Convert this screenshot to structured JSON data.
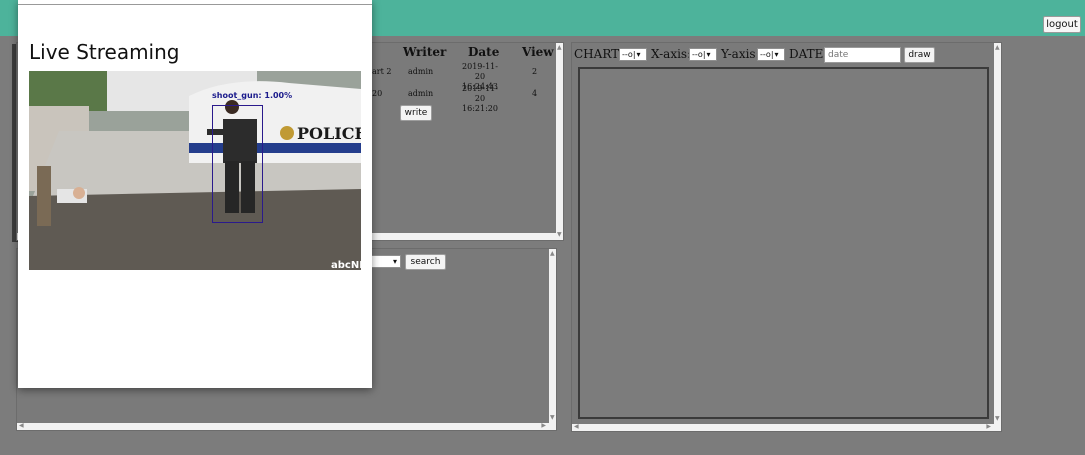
{
  "header": {
    "logout_label": "logout"
  },
  "board": {
    "columns": [
      "Writer",
      "Date",
      "View"
    ],
    "rows": [
      {
        "title": "art 2",
        "writer": "admin",
        "date": "2019-11-20",
        "time": "16:24:43",
        "views": "2"
      },
      {
        "title": "20",
        "writer": "admin",
        "date": "2019-11-20",
        "time": "16:21:20",
        "views": "4"
      }
    ],
    "write_label": "write"
  },
  "search": {
    "button_label": "search",
    "select_arrow": "▾"
  },
  "chart_controls": {
    "chart_label": "CHART:",
    "xaxis_label": "X-axis:",
    "yaxis_label": "Y-axis:",
    "date_label": "DATE:",
    "chart_select_value": "--o|",
    "xaxis_select_value": "--o|",
    "yaxis_select_value": "--o|",
    "date_placeholder": "date",
    "draw_label": "draw"
  },
  "modal": {
    "title": "Live Streaming",
    "detection_label": "shoot_gun: 1.00%",
    "watermark": "abcNEWS",
    "car_text": "POLICE"
  }
}
